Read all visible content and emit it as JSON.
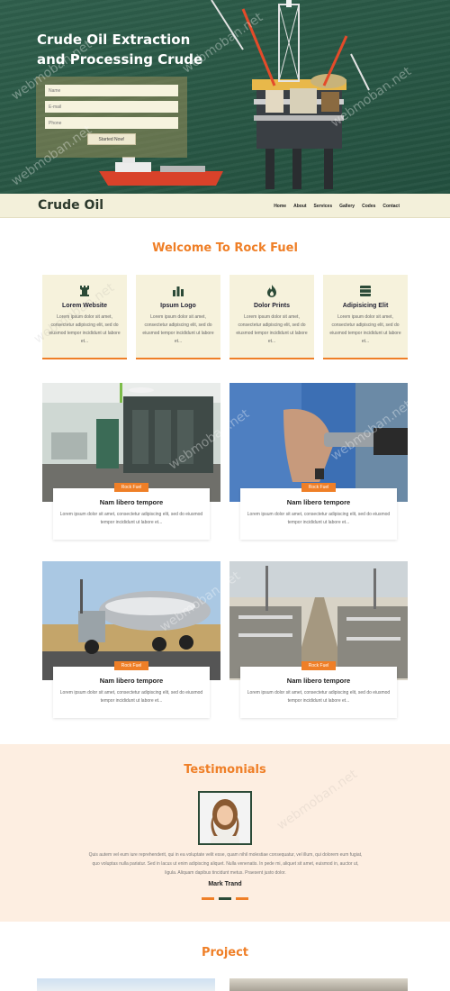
{
  "hero": {
    "title": "Crude Oil Extraction and Processing Crude",
    "form": {
      "name_placeholder": "Name",
      "email_placeholder": "E-mail",
      "phone_placeholder": "Phone",
      "submit_label": "Started Now!"
    }
  },
  "nav": {
    "brand": "Crude Oil",
    "items": [
      "Home",
      "About",
      "Services",
      "Gallery",
      "Codes",
      "Contact"
    ]
  },
  "welcome": {
    "title": "Welcome To Rock Fuel",
    "features": [
      {
        "icon": "chess-rook-icon",
        "title": "Lorem Website",
        "desc": "Lorem ipsum dolor sit amet, consectetur adipiscing elit, sed do eiusmod tempor incididunt ut labore et..."
      },
      {
        "icon": "bar-chart-icon",
        "title": "Ipsum Logo",
        "desc": "Lorem ipsum dolor sit amet, consectetur adipiscing elit, sed do eiusmod tempor incididunt ut labore et..."
      },
      {
        "icon": "fire-icon",
        "title": "Dolor Prints",
        "desc": "Lorem ipsum dolor sit amet, consectetur adipiscing elit, sed do eiusmod tempor incididunt ut labore et..."
      },
      {
        "icon": "barrel-icon",
        "title": "Adipisicing Elit",
        "desc": "Lorem ipsum dolor sit amet, consectetur adipiscing elit, sed do eiusmod tempor incididunt ut labore et..."
      }
    ]
  },
  "cards": [
    {
      "tag": "Rock Fuel",
      "title": "Nam libero tempore",
      "desc": "Lorem ipsum dolor sit amet, consectetur adipiscing elit, sed do eiusmod tempor incididunt ut labore et..."
    },
    {
      "tag": "Rock Fuel",
      "title": "Nam libero tempore",
      "desc": "Lorem ipsum dolor sit amet, consectetur adipiscing elit, sed do eiusmod tempor incididunt ut labore et..."
    },
    {
      "tag": "Rock Fuel",
      "title": "Nam libero tempore",
      "desc": "Lorem ipsum dolor sit amet, consectetur adipiscing elit, sed do eiusmod tempor incididunt ut labore et..."
    },
    {
      "tag": "Rock Fuel",
      "title": "Nam libero tempore",
      "desc": "Lorem ipsum dolor sit amet, consectetur adipiscing elit, sed do eiusmod tempor incididunt ut labore et..."
    }
  ],
  "testimonials": {
    "title": "Testimonials",
    "quote": "Quis autem vel eum iure reprehenderit, qui in ea voluptate velit esse, quam nihil molestiae consequatur, vel illum, qui dolorem eum fugiat, quo voluptas nulla pariatur. Sed in lacus ut enim adipiscing aliquet. Nulla venenatis. In pede mi, aliquet sit amet, euismod in, auctor ut, ligula. Aliquam dapibus tincidunt metus. Praesent justo dolor.",
    "author": "Mark Trand"
  },
  "project": {
    "title": "Project"
  },
  "watermark": "webmoban.net",
  "colors": {
    "accent": "#ef7f27",
    "dark_green": "#2b4a37",
    "cream": "#f6f2dc"
  }
}
